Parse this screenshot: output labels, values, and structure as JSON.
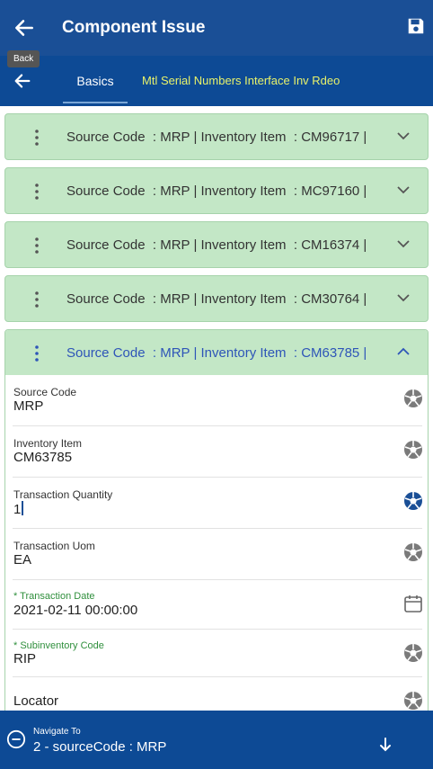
{
  "header": {
    "title": "Component Issue",
    "back_tooltip": "Back"
  },
  "tabs": [
    {
      "label": "Basics"
    },
    {
      "label": "Mtl Serial Numbers Interface Inv Rdeo"
    }
  ],
  "cards": [
    {
      "summary": "Source Code  : MRP | Inventory Item  : CM96717 |"
    },
    {
      "summary": "Source Code  : MRP | Inventory Item  : MC97160 |"
    },
    {
      "summary": "Source Code  : MRP | Inventory Item  : CM16374 |"
    },
    {
      "summary": "Source Code  : MRP | Inventory Item  : CM30764 |"
    },
    {
      "summary": "Source Code  : MRP | Inventory Item  : CM63785 |"
    }
  ],
  "fields": [
    {
      "label": "Source Code",
      "value": "MRP"
    },
    {
      "label": "Inventory Item",
      "value": "CM63785"
    },
    {
      "label": "Transaction Quantity",
      "value": "1"
    },
    {
      "label": "Transaction Uom",
      "value": "EA"
    },
    {
      "label": "* Transaction Date",
      "value": "2021-02-11 00:00:00"
    },
    {
      "label": "* Subinventory Code",
      "value": "RIP"
    },
    {
      "label": "Locator",
      "value": ""
    }
  ],
  "footer": {
    "navigate_label": "Navigate To",
    "navigate_value": "2 - sourceCode : MRP"
  },
  "colors": {
    "header": "#1a4f96",
    "tabbar": "#0d4a95",
    "card": "#c3e7c6",
    "active_tab_text": "#e8f26a",
    "required_label": "#2f8f3c",
    "expanded_summary": "#2e55b8"
  },
  "icons": {
    "back": "arrow-left-icon",
    "save": "floppy-disk-icon",
    "row_menu": "vertical-dots-icon",
    "expand": "chevron-down-icon",
    "collapse": "chevron-up-icon",
    "lookup": "aperture-icon",
    "date": "calendar-icon",
    "navigate": "minus-circle-icon",
    "down": "arrow-down-icon"
  }
}
